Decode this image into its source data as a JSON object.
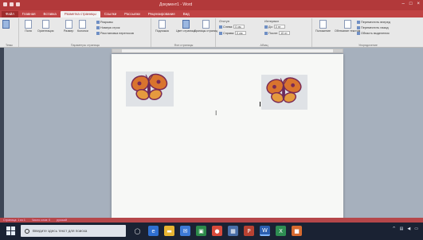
{
  "titlebar": {
    "document_title": "Документ1 - Word"
  },
  "tabs": [
    {
      "label": "Файл",
      "kind": "file"
    },
    {
      "label": "Главная",
      "kind": "normal"
    },
    {
      "label": "Вставка",
      "kind": "normal"
    },
    {
      "label": "Разметка страницы",
      "kind": "active"
    },
    {
      "label": "Ссылки",
      "kind": "normal"
    },
    {
      "label": "Рассылки",
      "kind": "normal"
    },
    {
      "label": "Рецензирование",
      "kind": "normal"
    },
    {
      "label": "Вид",
      "kind": "normal"
    }
  ],
  "ribbon": {
    "themes_label": "Темы",
    "page_setup": {
      "margins": "Поля",
      "orientation": "Ориентация",
      "size": "Размер",
      "columns": "Колонки",
      "breaks": "Разрывы",
      "line_numbers": "Номера строк",
      "hyphenation": "Расстановка переносов",
      "group_label": "Параметры страницы"
    },
    "page_background": {
      "watermark": "Подложка",
      "page_color": "Цвет страницы",
      "page_borders": "Границы страниц",
      "group_label": "Фон страницы"
    },
    "paragraph": {
      "indent_header": "Отступ",
      "indent_left_label": "Слева:",
      "indent_left_value": "0 см",
      "indent_right_label": "Справа:",
      "indent_right_value": "0 см",
      "spacing_header": "Интервал",
      "spacing_before_label": "До:",
      "spacing_before_value": "0 пт",
      "spacing_after_label": "После:",
      "spacing_after_value": "10 пт",
      "group_label": "Абзац"
    },
    "arrange": {
      "position": "Положение",
      "wrap_text": "Обтекание текстом",
      "bring_forward": "Переместить вперед",
      "send_backward": "Переместить назад",
      "selection_pane": "Область выделения",
      "group_label": "Упорядочение"
    }
  },
  "statusbar": {
    "page": "Страница: 1 из 1",
    "words": "Число слов: 0",
    "language": "русский"
  },
  "taskbar": {
    "search_placeholder": "Введите здесь текст для поиска"
  }
}
